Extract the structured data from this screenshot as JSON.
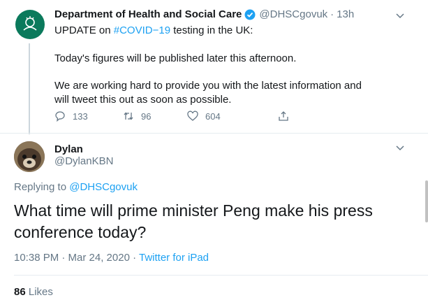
{
  "parent_tweet": {
    "author_name": "Department of Health and Social Care",
    "author_handle": "@DHSCgovuk",
    "time": "13h",
    "line1_prefix": "UPDATE on ",
    "hashtag": "#COVID−19",
    "line1_suffix": " testing in the UK:",
    "line2": "Today's figures will be published later this afternoon.",
    "line3": "We are working hard to provide you with the latest information and",
    "line4": "will tweet this out as soon as possible.",
    "replies": "133",
    "retweets": "96",
    "likes": "604",
    "icons": [
      "verified-badge-icon",
      "chevron-down-icon",
      "reply-icon",
      "retweet-icon",
      "like-icon",
      "share-icon"
    ]
  },
  "reply_tweet": {
    "author_name": "Dylan",
    "author_handle": "@DylanKBN",
    "replying_prefix": "Replying to ",
    "replying_to": "@DHSCgovuk",
    "text": "What time will prime minister Peng make his press conference today?",
    "timestamp": "10:38 PM · Mar 24, 2020 · ",
    "source": "Twitter for iPad",
    "likes_count": "86",
    "likes_label": "Likes"
  },
  "colors": {
    "link": "#1da1f2",
    "secondary": "#657786",
    "text": "#14171a",
    "divider": "#e6ecf0"
  }
}
